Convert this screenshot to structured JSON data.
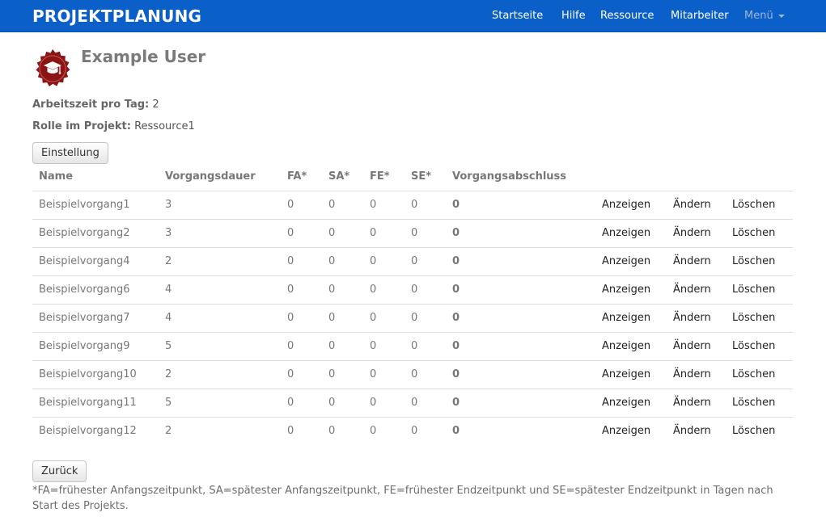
{
  "navbar": {
    "brand": "PROJEKTPLANUNG",
    "items": [
      {
        "label": "Startseite"
      },
      {
        "label": "Hilfe"
      },
      {
        "label": "Ressource"
      },
      {
        "label": "Mitarbeiter"
      },
      {
        "label": "Menü",
        "disabled": true
      }
    ]
  },
  "user": {
    "name": "Example User",
    "avatar_icon": "graduation-cap-seal-icon",
    "avatar_color": "#8b1414",
    "worktime_label": "Arbeitszeit pro Tag:",
    "worktime_value": "2",
    "role_label": "Rolle im Projekt:",
    "role_value": "Ressource1"
  },
  "buttons": {
    "settings": "Einstellung",
    "back": "Zurück"
  },
  "table": {
    "headers": [
      "Name",
      "Vorgangsdauer",
      "FA*",
      "SA*",
      "FE*",
      "SE*",
      "Vorgangsabschluss",
      "",
      "",
      ""
    ],
    "action_labels": {
      "show": "Anzeigen",
      "edit": "Ändern",
      "delete": "Löschen"
    },
    "rows": [
      {
        "name": "Beispielvorgang1",
        "duration": "3",
        "fa": "0",
        "sa": "0",
        "fe": "0",
        "se": "0",
        "done": "0"
      },
      {
        "name": "Beispielvorgang2",
        "duration": "3",
        "fa": "0",
        "sa": "0",
        "fe": "0",
        "se": "0",
        "done": "0"
      },
      {
        "name": "Beispielvorgang4",
        "duration": "2",
        "fa": "0",
        "sa": "0",
        "fe": "0",
        "se": "0",
        "done": "0"
      },
      {
        "name": "Beispielvorgang6",
        "duration": "4",
        "fa": "0",
        "sa": "0",
        "fe": "0",
        "se": "0",
        "done": "0"
      },
      {
        "name": "Beispielvorgang7",
        "duration": "4",
        "fa": "0",
        "sa": "0",
        "fe": "0",
        "se": "0",
        "done": "0"
      },
      {
        "name": "Beispielvorgang9",
        "duration": "5",
        "fa": "0",
        "sa": "0",
        "fe": "0",
        "se": "0",
        "done": "0"
      },
      {
        "name": "Beispielvorgang10",
        "duration": "2",
        "fa": "0",
        "sa": "0",
        "fe": "0",
        "se": "0",
        "done": "0"
      },
      {
        "name": "Beispielvorgang11",
        "duration": "5",
        "fa": "0",
        "sa": "0",
        "fe": "0",
        "se": "0",
        "done": "0"
      },
      {
        "name": "Beispielvorgang12",
        "duration": "2",
        "fa": "0",
        "sa": "0",
        "fe": "0",
        "se": "0",
        "done": "0"
      }
    ]
  },
  "footnote": "*FA=frühester Anfangszeitpunkt, SA=spätester Anfangszeitpunkt, FE=frühester Endzeitpunkt und SE=spätester Endzeitpunkt in Tagen nach Start des Projekts.",
  "colors": {
    "navbar": "#0b5fc9",
    "brand_text": "#ffffff",
    "nav_disabled": "#9fb6d8"
  }
}
